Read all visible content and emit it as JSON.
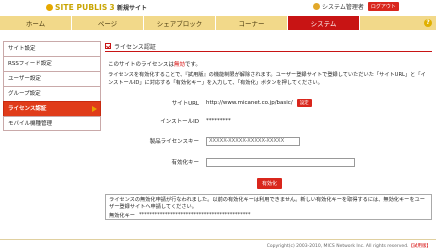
{
  "header": {
    "logo_text": "SITE PUBLIS",
    "logo_version": "3",
    "site_name": "新規サイト",
    "user_label": "システム管理者",
    "logout_label": "ログアウト"
  },
  "nav": {
    "tabs": [
      {
        "label": "ホーム"
      },
      {
        "label": "ページ"
      },
      {
        "label": "シェアブロック"
      },
      {
        "label": "コーナー"
      },
      {
        "label": "システム"
      }
    ],
    "help": "?"
  },
  "sidebar": {
    "items": [
      {
        "label": "サイト設定"
      },
      {
        "label": "RSSフィード設定"
      },
      {
        "label": "ユーザー設定"
      },
      {
        "label": "グループ設定"
      },
      {
        "label": "ライセンス認証"
      },
      {
        "label": "モバイル機種管理"
      }
    ]
  },
  "main": {
    "title": "ライセンス認証",
    "status_prefix": "このサイトのライセンスは",
    "status_value": "無効",
    "status_suffix": "です。",
    "description": "ライセンスを有効化することで、『試用版』の機能制限が解除されます。ユーザー登録サイトで登録していただいた「サイトURL」と「インストールID」に対応する「有効化キー」を入力して、「有効化」ボタンを押してください。",
    "site_url_label": "サイトURL",
    "site_url_value": "http://www.micanet.co.jp/basic/",
    "site_url_button": "設定",
    "install_id_label": "インストールID",
    "install_id_value": "*********",
    "product_key_label": "製品ライセンスキー",
    "product_key_value": "XXXXX-XXXXX-XXXXX-XXXXX",
    "activation_key_label": "有効化キー",
    "activation_key_value": "",
    "activate_button": "有効化",
    "notice_text": "ライセンスの無効化申請が行なわれました。以前の有効化キーは利用できません。新しい有効化キーを取得するには、無効化キーをユーザー登録サイトへ申請してください。",
    "notice_key_label": "無効化キー",
    "notice_key_value": "*******************************************"
  },
  "footer": {
    "copyright": "Copyright(c) 2003-2010, MICS Network Inc. All rights reserved.",
    "edition": "【試用版】"
  }
}
